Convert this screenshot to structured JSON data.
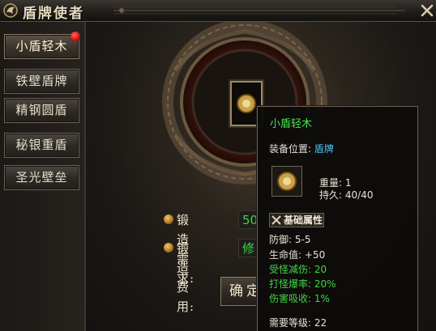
{
  "window": {
    "title": "盾牌使者"
  },
  "sidebar": {
    "tabs": [
      {
        "label": "小盾轻木",
        "active": true,
        "has_notification": true
      },
      {
        "label": "铁壁盾牌",
        "active": false,
        "has_notification": false
      },
      {
        "label": "精钢圆盾",
        "active": false,
        "has_notification": false
      },
      {
        "label": "秘银重盾",
        "active": false,
        "has_notification": false
      },
      {
        "label": "圣光壁垒",
        "active": false,
        "has_notification": false
      }
    ]
  },
  "forge": {
    "requirement_label": "锻造需求:",
    "requirement_value": "50",
    "cost_label": "锻造费用:",
    "cost_value": "修",
    "confirm_label": "确定"
  },
  "tooltip": {
    "item_name": "小盾轻木",
    "slot_label": "装备位置:",
    "slot_value": "盾牌",
    "weight_label": "重量:",
    "weight_value": "1",
    "durability_label": "持久:",
    "durability_value": "40/40",
    "attr_header": "基础属性",
    "attributes": [
      {
        "label": "防御:",
        "value": "5-5",
        "color": "#e8e2d6"
      },
      {
        "label": "生命值:",
        "value": "+50",
        "color": "#e8e2d6"
      },
      {
        "label": "受怪减伤:",
        "value": "20",
        "color": "#3ed840"
      },
      {
        "label": "打怪爆率:",
        "value": "20%",
        "color": "#3ed840"
      },
      {
        "label": "伤害吸收:",
        "value": "1%",
        "color": "#3ed840"
      }
    ],
    "level_label": "需要等级:",
    "level_value": "22"
  },
  "colors": {
    "accent_gold": "#c9a45a",
    "item_name_green": "#3ee84a",
    "info_blue": "#4fc4f0",
    "notification_red": "#d01010"
  },
  "icons": [
    "dragon-emblem-icon",
    "close-x-icon",
    "shield-coin-icon",
    "crossed-swords-icon",
    "gold-bullet-icon"
  ]
}
